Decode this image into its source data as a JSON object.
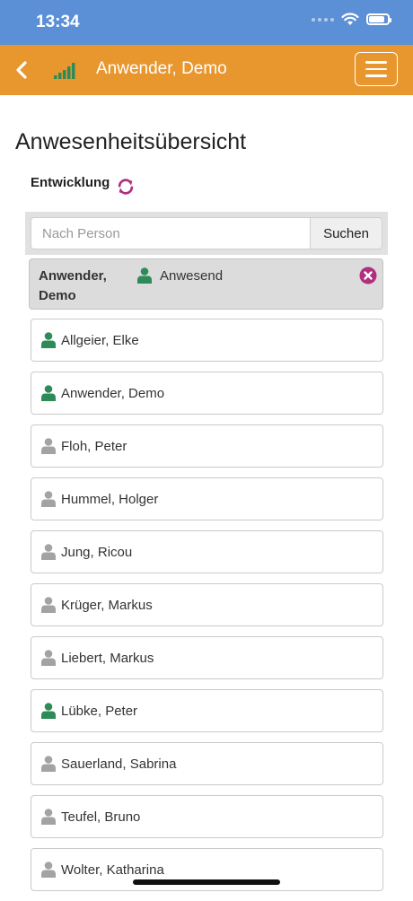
{
  "status_bar": {
    "time": "13:34"
  },
  "header": {
    "title": "Anwender, Demo"
  },
  "page": {
    "title": "Anwesenheitsübersicht"
  },
  "group": {
    "label": "Entwicklung"
  },
  "search": {
    "placeholder": "Nach Person",
    "value": "",
    "button_label": "Suchen"
  },
  "selected": {
    "name": "Anwender, Demo",
    "status": "Anwesend"
  },
  "colors": {
    "present": "#2e8b57",
    "absent": "#a3a3a3",
    "header": "#e8972f",
    "status_bar": "#5b8fd6",
    "accent": "#b0307f"
  },
  "persons": [
    {
      "name": "Allgeier, Elke",
      "present": true
    },
    {
      "name": "Anwender, Demo",
      "present": true
    },
    {
      "name": "Floh, Peter",
      "present": false
    },
    {
      "name": "Hummel, Holger",
      "present": false
    },
    {
      "name": "Jung, Ricou",
      "present": false
    },
    {
      "name": "Krüger, Markus",
      "present": false
    },
    {
      "name": "Liebert, Markus",
      "present": false
    },
    {
      "name": "Lübke, Peter",
      "present": true
    },
    {
      "name": "Sauerland, Sabrina",
      "present": false
    },
    {
      "name": "Teufel, Bruno",
      "present": false
    },
    {
      "name": "Wolter, Katharina",
      "present": false
    }
  ]
}
